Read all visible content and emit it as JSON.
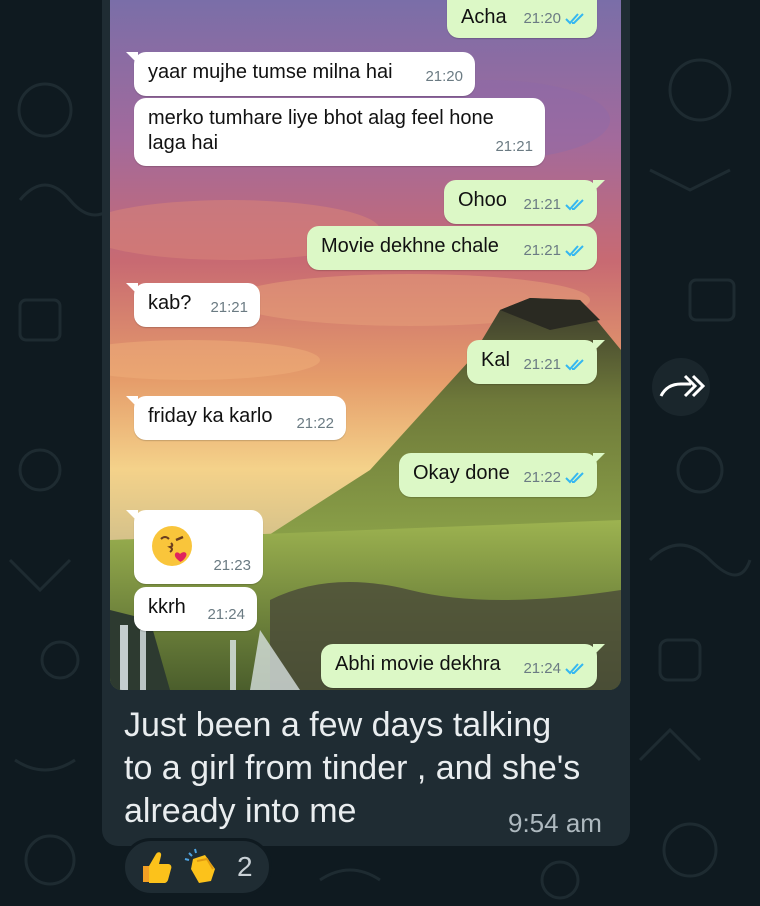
{
  "chat": {
    "messages": [
      {
        "dir": "out",
        "text": "Acha",
        "time": "21:20",
        "ticks": true
      },
      {
        "dir": "in",
        "text": "yaar mujhe tumse milna hai",
        "time": "21:20"
      },
      {
        "dir": "in",
        "text_line1": "merko tumhare liye bhot alag feel hone",
        "text_line2": "laga hai",
        "time": "21:21"
      },
      {
        "dir": "out",
        "text": "Ohoo",
        "time": "21:21",
        "ticks": true
      },
      {
        "dir": "out",
        "text": "Movie dekhne chale",
        "time": "21:21",
        "ticks": true
      },
      {
        "dir": "in",
        "text": "kab?",
        "time": "21:21"
      },
      {
        "dir": "out",
        "text": "Kal",
        "time": "21:21",
        "ticks": true
      },
      {
        "dir": "in",
        "text": "friday ka karlo",
        "time": "21:22"
      },
      {
        "dir": "out",
        "text": "Okay done",
        "time": "21:22",
        "ticks": true
      },
      {
        "dir": "in",
        "emoji": "face-blowing-kiss",
        "time": "21:23"
      },
      {
        "dir": "in",
        "text": "kkrh",
        "time": "21:24"
      },
      {
        "dir": "out",
        "text": "Abhi movie dekhra",
        "time": "21:24",
        "ticks": true
      }
    ]
  },
  "caption": {
    "text_line1": "Just been a few days talking",
    "text_line2": "to a girl from tinder , and she's",
    "text_line3": "already into me",
    "time": "9:54 am"
  },
  "reactions": {
    "emojis": [
      "thumbs-up",
      "clapping-hands"
    ],
    "count": "2"
  },
  "icons": {
    "forward": "forward-icon",
    "read_ticks": "double-check-icon"
  },
  "colors": {
    "outgoing_bubble": "#dcf8c6",
    "incoming_bubble": "#ffffff",
    "read_tick": "#34b7f1",
    "app_background": "#0f1a20",
    "message_bubble": "#1f2c33"
  }
}
